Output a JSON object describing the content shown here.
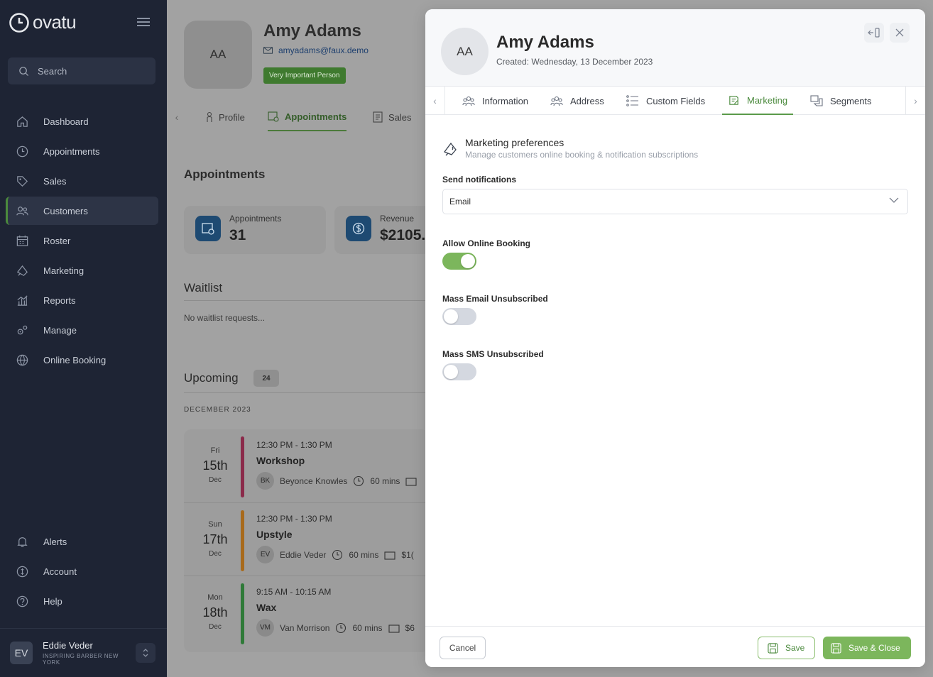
{
  "app": {
    "logo_text": "ovatu"
  },
  "sidebar": {
    "search_placeholder": "Search",
    "items": [
      {
        "label": "Dashboard",
        "icon": "home-icon"
      },
      {
        "label": "Appointments",
        "icon": "clock-icon"
      },
      {
        "label": "Sales",
        "icon": "tag-icon"
      },
      {
        "label": "Customers",
        "icon": "users-icon",
        "active": true
      },
      {
        "label": "Roster",
        "icon": "calendar-icon"
      },
      {
        "label": "Marketing",
        "icon": "megaphone-icon"
      },
      {
        "label": "Reports",
        "icon": "chart-icon"
      },
      {
        "label": "Manage",
        "icon": "gears-icon"
      },
      {
        "label": "Online Booking",
        "icon": "globe-icon"
      }
    ],
    "bottom_items": [
      {
        "label": "Alerts",
        "icon": "bell-icon"
      },
      {
        "label": "Account",
        "icon": "account-icon"
      },
      {
        "label": "Help",
        "icon": "help-icon"
      }
    ],
    "user": {
      "initials": "EV",
      "name": "Eddie Veder",
      "org": "INSPIRING BARBER NEW YORK"
    }
  },
  "main": {
    "initials": "AA",
    "name": "Amy Adams",
    "email": "amyadams@faux.demo",
    "tag": "Very Important Person",
    "tabs": [
      "Profile",
      "Appointments",
      "Sales"
    ],
    "appointments_heading": "Appointments",
    "stats": [
      {
        "label": "Appointments",
        "value": "31"
      },
      {
        "label": "Revenue",
        "value": "$2105."
      }
    ],
    "waitlist_heading": "Waitlist",
    "waitlist_empty": "No waitlist requests...",
    "upcoming_heading": "Upcoming",
    "upcoming_count": "24",
    "month": "DECEMBER 2023",
    "upcoming": [
      {
        "dow": "Fri",
        "day": "15th",
        "mon": "Dec",
        "time": "12:30 PM - 1:30 PM",
        "service": "Workshop",
        "staff_initials": "BK",
        "staff": "Beyonce Knowles",
        "duration": "60 mins",
        "price": "",
        "color": "#8b2a4a"
      },
      {
        "dow": "Sun",
        "day": "17th",
        "mon": "Dec",
        "time": "12:30 PM - 1:30 PM",
        "service": "Upstyle",
        "staff_initials": "EV",
        "staff": "Eddie Veder",
        "duration": "60 mins",
        "price": "$1(",
        "color": "#a86a1c"
      },
      {
        "dow": "Mon",
        "day": "18th",
        "mon": "Dec",
        "time": "9:15 AM - 10:15 AM",
        "service": "Wax",
        "staff_initials": "VM",
        "staff": "Van Morrison",
        "duration": "60 mins",
        "price": "$6",
        "color": "#2f7a38"
      }
    ]
  },
  "modal": {
    "initials": "AA",
    "name": "Amy Adams",
    "created": "Created: Wednesday, 13 December 2023",
    "tabs": [
      {
        "label": "Information",
        "icon": "info-users-icon"
      },
      {
        "label": "Address",
        "icon": "address-icon"
      },
      {
        "label": "Custom Fields",
        "icon": "list-icon"
      },
      {
        "label": "Marketing",
        "icon": "marketing-icon",
        "active": true
      },
      {
        "label": "Segments",
        "icon": "segments-icon"
      }
    ],
    "section_title": "Marketing preferences",
    "section_subtitle": "Manage customers online booking & notification subscriptions",
    "send_notifications_label": "Send notifications",
    "send_notifications_value": "Email",
    "allow_online_booking_label": "Allow Online Booking",
    "allow_online_booking": true,
    "mass_email_label": "Mass Email Unsubscribed",
    "mass_email": false,
    "mass_sms_label": "Mass SMS Unsubscribed",
    "mass_sms": false,
    "footer": {
      "cancel": "Cancel",
      "save": "Save",
      "save_close": "Save & Close"
    }
  },
  "colors": {
    "accent": "#7cb65c",
    "sidebar_bg": "#1e2434",
    "link": "#2a5a9a"
  }
}
